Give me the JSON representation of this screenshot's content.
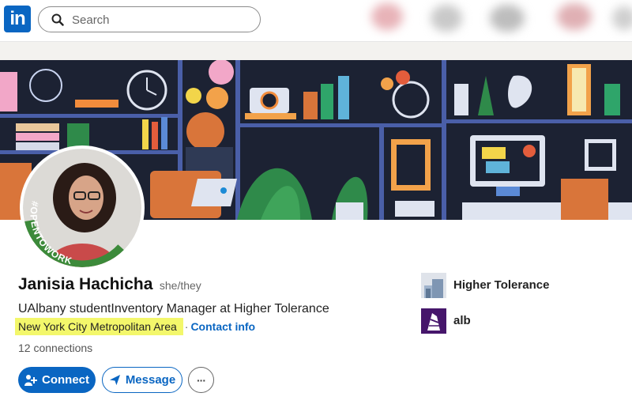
{
  "topbar": {
    "logo_text": "in",
    "search_placeholder": "Search"
  },
  "profile": {
    "name": "Janisia Hachicha",
    "pronouns": "she/they",
    "headline": "UAlbany studentInventory Manager at Higher Tolerance",
    "location": "New York City Metropolitan Area",
    "separator": "·",
    "contact_info": "Contact info",
    "connections": "12 connections",
    "open_to_work_badge": "#OPENTOWORK"
  },
  "actions": {
    "connect": "Connect",
    "message": "Message",
    "more": "···"
  },
  "experience": [
    {
      "label": "Higher Tolerance"
    },
    {
      "label": "alb"
    }
  ],
  "colors": {
    "brand_blue": "#0a66c2",
    "highlight": "#f3f76b",
    "open_to_work_green": "#3c8a3a"
  }
}
